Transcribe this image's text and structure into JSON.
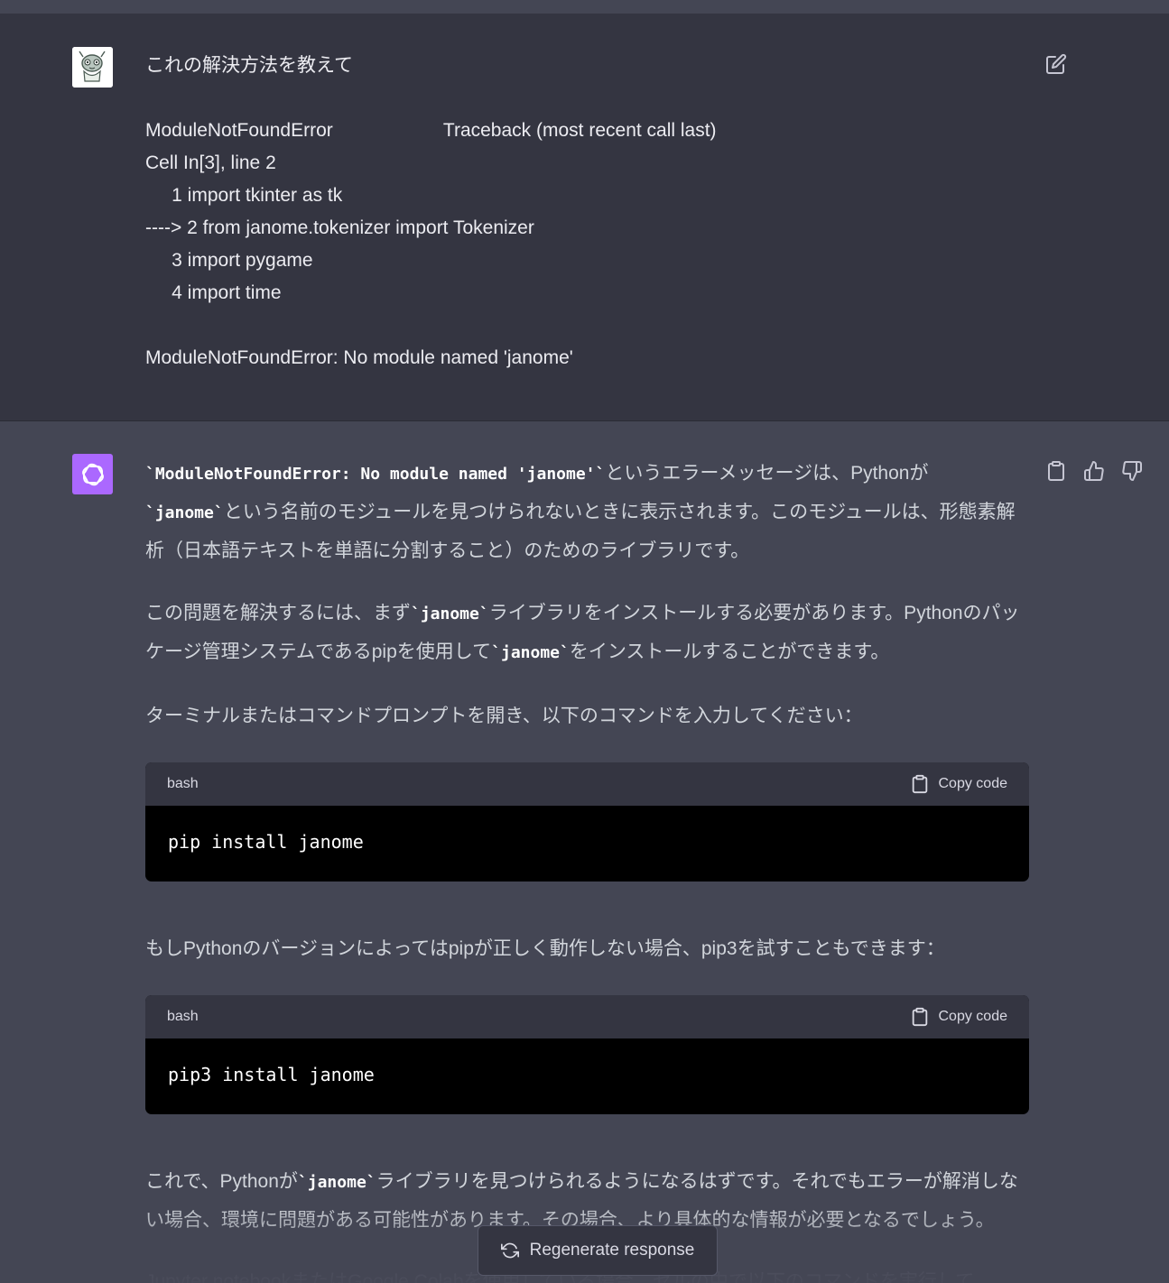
{
  "user_message": {
    "title": "これの解決方法を教えて",
    "lines": [
      "ModuleNotFoundError                     Traceback (most recent call last)",
      "Cell In[3], line 2",
      "     1 import tkinter as tk",
      "----> 2 from janome.tokenizer import Tokenizer",
      "     3 import pygame",
      "     4 import time",
      "",
      "ModuleNotFoundError: No module named 'janome'"
    ]
  },
  "assistant_message": {
    "p1": {
      "code1": "`ModuleNotFoundError: No module named 'janome'`",
      "text1": "というエラーメッセージは、Pythonが",
      "code2": "`janome`",
      "text2": "という名前のモジュールを見つけられないときに表示されます。このモジュールは、形態素解析（日本語テキストを単語に分割すること）のためのライブラリです。"
    },
    "p2": {
      "text1": "この問題を解決するには、まず",
      "code1": "`janome`",
      "text2": "ライブラリをインストールする必要があります。Pythonのパッケージ管理システムであるpipを使用して",
      "code2": "`janome`",
      "text3": "をインストールすることができます。"
    },
    "p3": "ターミナルまたはコマンドプロンプトを開き、以下のコマンドを入力してください：",
    "code_block_1": {
      "lang": "bash",
      "copy_label": "Copy code",
      "code": "pip install janome"
    },
    "p4": "もしPythonのバージョンによってはpipが正しく動作しない場合、pip3を試すこともできます：",
    "code_block_2": {
      "lang": "bash",
      "copy_label": "Copy code",
      "code": "pip3 install janome"
    },
    "p5": {
      "text1": "これで、Pythonが",
      "code1": "`janome`",
      "text2": "ライブラリを見つけられるようになるはずです。それでもエラーが解消しない場合、環境に問題がある可能性があります。その場合、より具体的な情報が必要となるでしょう。"
    },
    "p6": "Jupyter notebookまたはGoogle Colabを使用している場合、セルの中で以下のコマンドを実行して"
  },
  "regenerate_label": "Regenerate response",
  "colors": {
    "user_bg": "#343541",
    "assistant_bg": "#444654",
    "gpt_avatar": "#ab68ff",
    "code_bg": "#000000"
  },
  "icons": [
    "edit-icon",
    "clipboard-icon",
    "thumbs-up-icon",
    "thumbs-down-icon",
    "refresh-icon",
    "openai-logo-icon"
  ]
}
